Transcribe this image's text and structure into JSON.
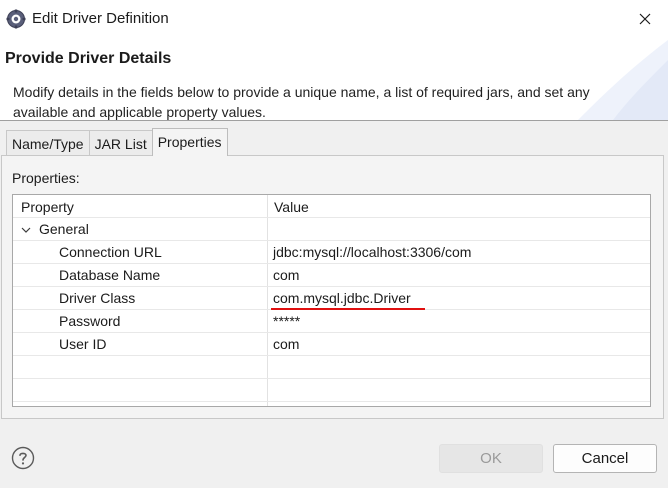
{
  "window": {
    "title": "Edit Driver Definition"
  },
  "header": {
    "title": "Provide Driver Details",
    "description": "Modify details in the fields below to provide a unique name, a list of required jars, and set any available and applicable property values."
  },
  "tabs": [
    {
      "label": "Name/Type",
      "active": false
    },
    {
      "label": "JAR List",
      "active": false
    },
    {
      "label": "Properties",
      "active": true
    }
  ],
  "properties_panel": {
    "label": "Properties:",
    "columns": {
      "property": "Property",
      "value": "Value"
    },
    "group": "General",
    "rows": [
      {
        "property": "Connection URL",
        "value": "jdbc:mysql://localhost:3306/com"
      },
      {
        "property": "Database Name",
        "value": "com"
      },
      {
        "property": "Driver Class",
        "value": "com.mysql.jdbc.Driver"
      },
      {
        "property": "Password",
        "value": "*****"
      },
      {
        "property": "User ID",
        "value": "com"
      }
    ]
  },
  "buttons": {
    "ok": "OK",
    "cancel": "Cancel"
  },
  "colors": {
    "highlight_underline": "#e01010",
    "accent": "#2d5fa8"
  },
  "icons": [
    "app-gear-icon",
    "close-icon",
    "chevron-down-icon",
    "help-icon"
  ]
}
